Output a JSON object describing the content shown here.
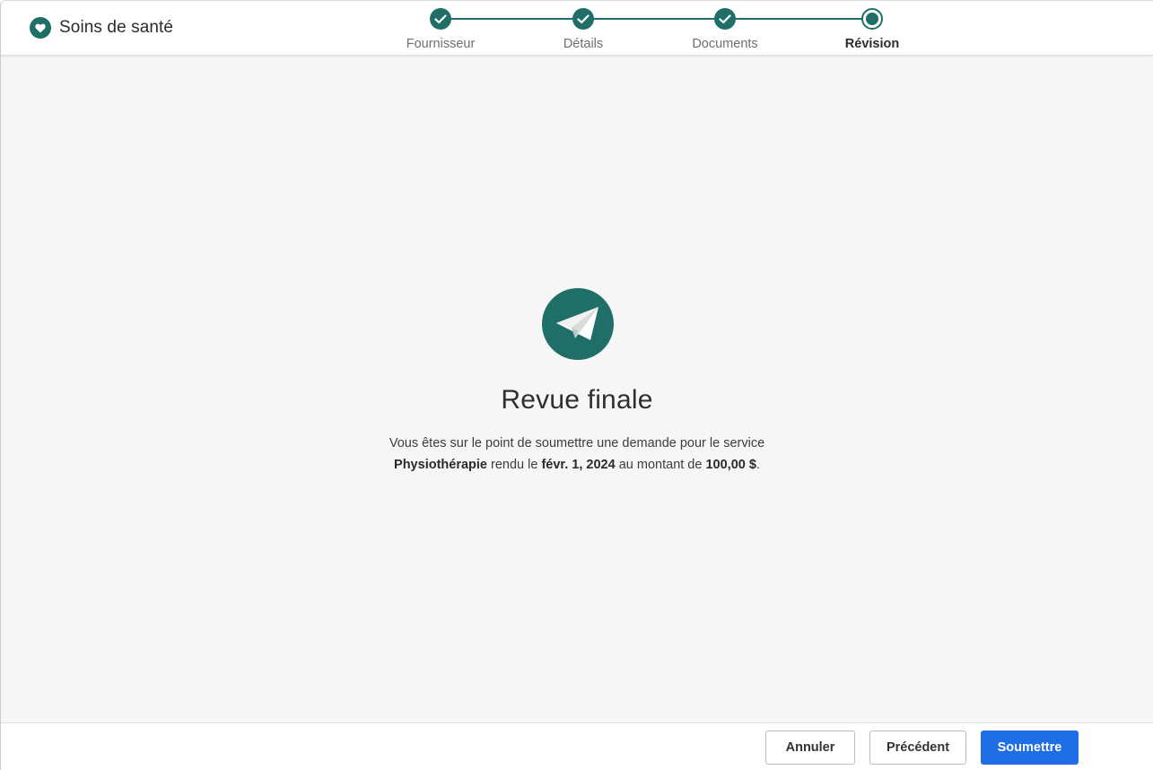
{
  "colors": {
    "teal": "#1f6f68",
    "primary_button": "#1f6ee6",
    "main_background": "#f6f6f6"
  },
  "header": {
    "brand_icon": "heart-icon",
    "title": "Soins de santé"
  },
  "stepper": {
    "steps": [
      {
        "label": "Fournisseur",
        "state": "completed",
        "icon": "check-icon"
      },
      {
        "label": "Détails",
        "state": "completed",
        "icon": "check-icon"
      },
      {
        "label": "Documents",
        "state": "completed",
        "icon": "check-icon"
      },
      {
        "label": "Révision",
        "state": "current",
        "icon": "current-step-icon"
      }
    ]
  },
  "main": {
    "icon": "paper-plane-icon",
    "title": "Revue finale",
    "message": {
      "line1": "Vous êtes sur le point de soumettre une demande pour le service",
      "service": "Physiothérapie",
      "connector1": " rendu le ",
      "date": "févr. 1, 2024",
      "connector2": " au montant de ",
      "amount": "100,00 $",
      "end": "."
    }
  },
  "footer": {
    "cancel_label": "Annuler",
    "previous_label": "Précédent",
    "submit_label": "Soumettre"
  }
}
